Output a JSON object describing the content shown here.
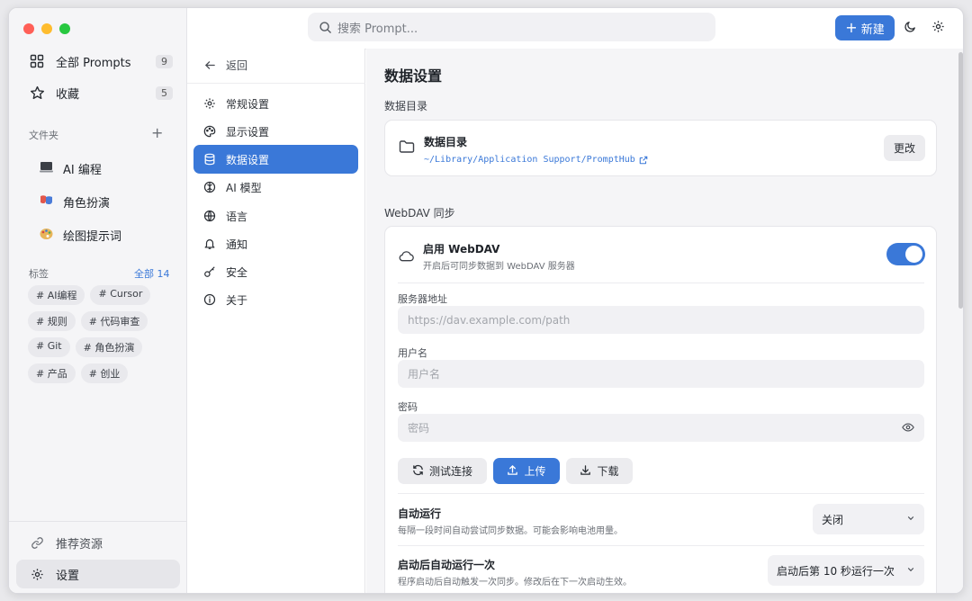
{
  "window": {
    "traffic_colors": [
      "#ff5f57",
      "#febc2e",
      "#28c840"
    ]
  },
  "sidebar": {
    "items": [
      {
        "label": "全部 Prompts",
        "count": "9",
        "icon": "grid-icon"
      },
      {
        "label": "收藏",
        "count": "5",
        "icon": "star-icon"
      }
    ],
    "folders_title": "文件夹",
    "folders": [
      {
        "label": "AI 编程",
        "icon": "laptop-icon"
      },
      {
        "label": "角色扮演",
        "icon": "mask-icon"
      },
      {
        "label": "绘图提示词",
        "icon": "palette-icon"
      }
    ],
    "tags_title": "标签",
    "tags_all": "全部 14",
    "tags": [
      "# AI编程",
      "# Cursor",
      "# 规则",
      "# 代码审查",
      "# Git",
      "# 角色扮演",
      "# 产品",
      "# 创业"
    ],
    "bottom": [
      {
        "label": "推荐资源",
        "icon": "link-icon"
      },
      {
        "label": "设置",
        "icon": "gear-icon"
      }
    ]
  },
  "settings_nav": {
    "back_label": "返回",
    "items": [
      {
        "label": "常规设置",
        "icon": "gear-icon"
      },
      {
        "label": "显示设置",
        "icon": "palette-icon"
      },
      {
        "label": "数据设置",
        "icon": "database-icon"
      },
      {
        "label": "AI 模型",
        "icon": "brain-icon"
      },
      {
        "label": "语言",
        "icon": "globe-icon"
      },
      {
        "label": "通知",
        "icon": "bell-icon"
      },
      {
        "label": "安全",
        "icon": "key-icon"
      },
      {
        "label": "关于",
        "icon": "info-icon"
      }
    ],
    "active_index": 2
  },
  "topbar": {
    "search_placeholder": "搜索 Prompt...",
    "new_label": "新建"
  },
  "main": {
    "title": "数据设置",
    "data_dir_section": "数据目录",
    "data_dir_card": {
      "title": "数据目录",
      "path": "~/Library/Application Support/PromptHub",
      "change_label": "更改"
    },
    "webdav_section": "WebDAV 同步",
    "webdav": {
      "enable_title": "启用 WebDAV",
      "enable_desc": "开启后可同步数据到 WebDAV 服务器",
      "enabled": true,
      "server_label": "服务器地址",
      "server_placeholder": "https://dav.example.com/path",
      "user_label": "用户名",
      "user_placeholder": "用户名",
      "pass_label": "密码",
      "pass_placeholder": "密码",
      "test_label": "测试连接",
      "upload_label": "上传",
      "download_label": "下载",
      "auto_title": "自动运行",
      "auto_desc": "每隔一段时间自动尝试同步数据。可能会影响电池用量。",
      "auto_value": "关闭",
      "startup_title": "启动后自动运行一次",
      "startup_desc": "程序启动后自动触发一次同步。修改后在下一次启动生效。",
      "startup_value": "启动后第 10 秒运行一次"
    }
  },
  "colors": {
    "accent": "#3a78d8"
  }
}
